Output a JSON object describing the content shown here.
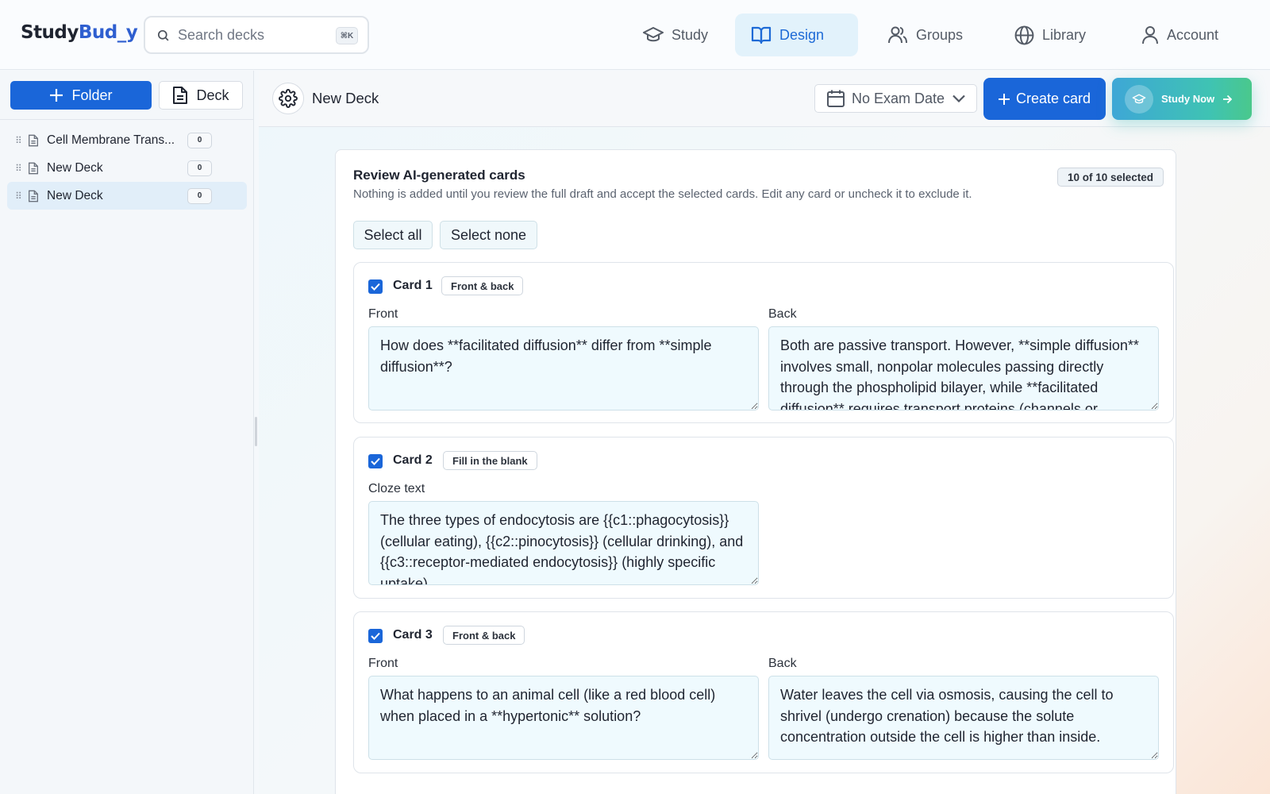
{
  "app": {
    "logo_part1": "Study",
    "logo_part2": "Bud_y"
  },
  "search": {
    "placeholder": "Search decks",
    "shortcut": "⌘K"
  },
  "nav": {
    "items": [
      {
        "label": "Study",
        "icon": "graduation-cap-icon"
      },
      {
        "label": "Design",
        "icon": "open-book-icon",
        "active": true
      },
      {
        "label": "Groups",
        "icon": "users-icon"
      },
      {
        "label": "Library",
        "icon": "globe-icon"
      },
      {
        "label": "Account",
        "icon": "user-icon"
      }
    ]
  },
  "sidebar": {
    "folder_button": "Folder",
    "deck_button": "Deck",
    "decks": [
      {
        "name": "Cell Membrane Trans...",
        "count": "0"
      },
      {
        "name": "New Deck",
        "count": "0"
      },
      {
        "name": "New Deck",
        "count": "0",
        "selected": true
      }
    ]
  },
  "toolbar": {
    "deck_title": "New Deck",
    "exam_date": "No Exam Date",
    "create_card": "Create card",
    "study_now": "Study Now"
  },
  "review": {
    "title": "Review AI-generated cards",
    "subtitle": "Nothing is added until you review the full draft and accept the selected cards. Edit any card or uncheck it to exclude it.",
    "selected_badge": "10 of 10 selected",
    "select_all": "Select all",
    "select_none": "Select none",
    "cards": [
      {
        "title": "Card 1",
        "type": "Front & back",
        "checked": true,
        "front_label": "Front",
        "back_label": "Back",
        "front": "How does **facilitated diffusion** differ from **simple diffusion**?",
        "back": "Both are passive transport. However, **simple diffusion** involves small, nonpolar molecules passing directly through the phospholipid bilayer, while **facilitated diffusion** requires transport proteins (channels or"
      },
      {
        "title": "Card 2",
        "type": "Fill in the blank",
        "checked": true,
        "cloze_label": "Cloze text",
        "cloze": "The three types of endocytosis are {{c1::phagocytosis}} (cellular eating), {{c2::pinocytosis}} (cellular drinking), and {{c3::receptor-mediated endocytosis}} (highly specific uptake)."
      },
      {
        "title": "Card 3",
        "type": "Front & back",
        "checked": true,
        "front_label": "Front",
        "back_label": "Back",
        "front": "What happens to an animal cell (like a red blood cell) when placed in a **hypertonic** solution?",
        "back": "Water leaves the cell via osmosis, causing the cell to shrivel (undergo crenation) because the solute concentration outside the cell is higher than inside."
      }
    ]
  },
  "colors": {
    "primary": "#1a66d9",
    "nav_active_bg": "#e2f2fb",
    "textarea_bg": "#effafe"
  }
}
